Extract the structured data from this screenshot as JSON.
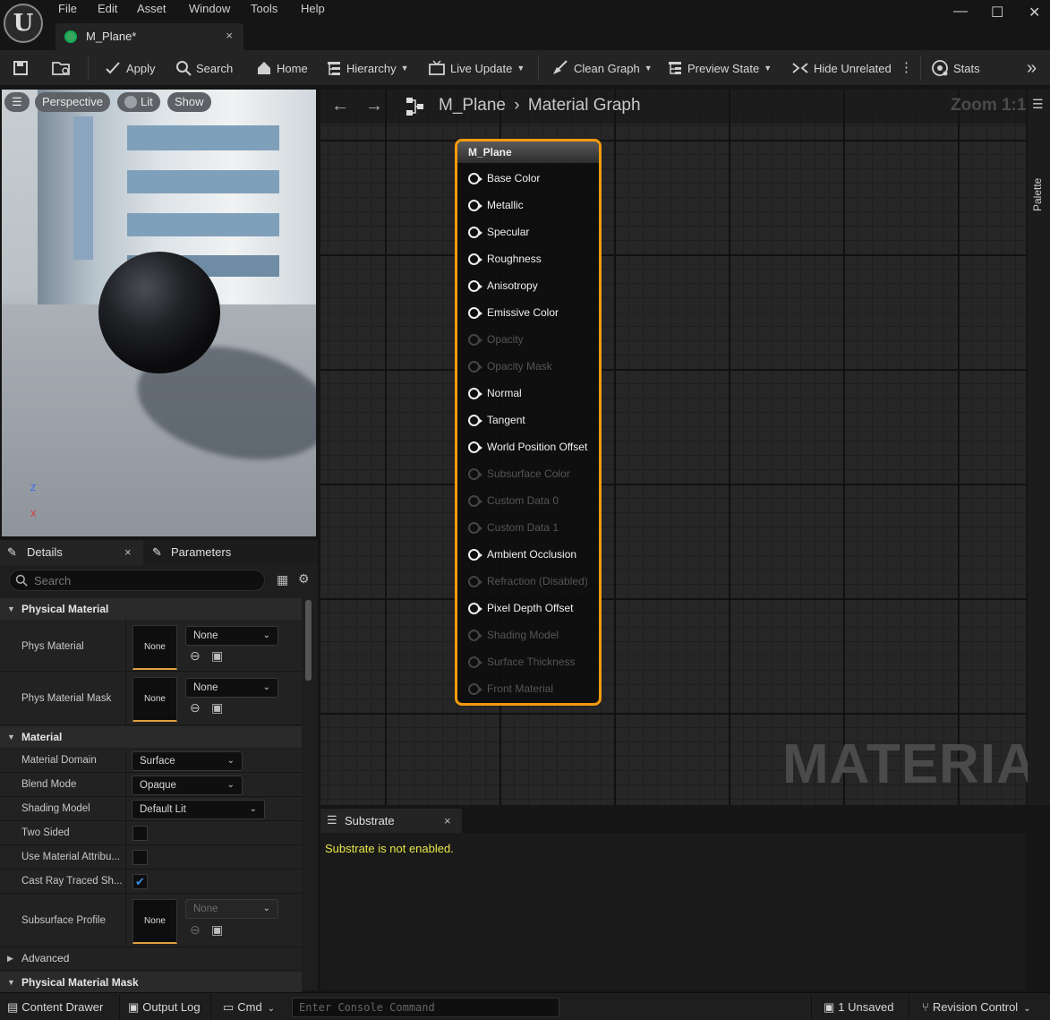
{
  "menu": {
    "items": [
      "File",
      "Edit",
      "Asset",
      "Window",
      "Tools",
      "Help"
    ]
  },
  "document_tab": {
    "title": "M_Plane*",
    "close": "×"
  },
  "window_controls": {
    "minimize": "—",
    "maximize": "☐",
    "close": "✕"
  },
  "toolbar": {
    "apply": "Apply",
    "search": "Search",
    "home": "Home",
    "hierarchy": "Hierarchy",
    "live_update": "Live Update",
    "clean_graph": "Clean Graph",
    "preview_state": "Preview State",
    "hide_unrelated": "Hide Unrelated",
    "stats": "Stats"
  },
  "viewport": {
    "perspective": "Perspective",
    "lit": "Lit",
    "show": "Show",
    "axis_z": "Z",
    "axis_x": "X"
  },
  "details_panel": {
    "tab_details": "Details",
    "tab_close": "×",
    "tab_parameters": "Parameters",
    "search_placeholder": "Search",
    "sections": {
      "physical_material": "Physical Material",
      "material": "Material",
      "advanced": "Advanced",
      "physical_material_mask": "Physical Material Mask"
    },
    "phys_material": {
      "label": "Phys Material",
      "thumb": "None",
      "value": "None"
    },
    "phys_material_mask": {
      "label": "Phys Material Mask",
      "thumb": "None",
      "value": "None"
    },
    "material_domain": {
      "label": "Material Domain",
      "value": "Surface"
    },
    "blend_mode": {
      "label": "Blend Mode",
      "value": "Opaque"
    },
    "shading_model": {
      "label": "Shading Model",
      "value": "Default Lit"
    },
    "two_sided": {
      "label": "Two Sided",
      "checked": false
    },
    "use_material_attributes": {
      "label": "Use Material Attribu...",
      "checked": false
    },
    "cast_ray_traced": {
      "label": "Cast Ray Traced Sh...",
      "checked": true
    },
    "subsurface_profile": {
      "label": "Subsurface Profile",
      "thumb": "None",
      "value": "None"
    }
  },
  "graph": {
    "breadcrumb_root": "M_Plane",
    "breadcrumb_sep": "›",
    "breadcrumb_leaf": "Material Graph",
    "zoom": "Zoom 1:1",
    "watermark": "MATERIAL",
    "palette": "Palette",
    "node": {
      "title": "M_Plane",
      "pins": [
        {
          "label": "Base Color",
          "enabled": true
        },
        {
          "label": "Metallic",
          "enabled": true
        },
        {
          "label": "Specular",
          "enabled": true
        },
        {
          "label": "Roughness",
          "enabled": true
        },
        {
          "label": "Anisotropy",
          "enabled": true
        },
        {
          "label": "Emissive Color",
          "enabled": true
        },
        {
          "label": "Opacity",
          "enabled": false
        },
        {
          "label": "Opacity Mask",
          "enabled": false
        },
        {
          "label": "Normal",
          "enabled": true
        },
        {
          "label": "Tangent",
          "enabled": true
        },
        {
          "label": "World Position Offset",
          "enabled": true
        },
        {
          "label": "Subsurface Color",
          "enabled": false
        },
        {
          "label": "Custom Data 0",
          "enabled": false
        },
        {
          "label": "Custom Data 1",
          "enabled": false
        },
        {
          "label": "Ambient Occlusion",
          "enabled": true
        },
        {
          "label": "Refraction (Disabled)",
          "enabled": false
        },
        {
          "label": "Pixel Depth Offset",
          "enabled": true
        },
        {
          "label": "Shading Model",
          "enabled": false
        },
        {
          "label": "Surface Thickness",
          "enabled": false
        },
        {
          "label": "Front Material",
          "enabled": false
        }
      ]
    }
  },
  "substrate": {
    "tab": "Substrate",
    "close": "×",
    "message": "Substrate is not enabled."
  },
  "statusbar": {
    "content_drawer": "Content Drawer",
    "output_log": "Output Log",
    "cmd": "Cmd",
    "console_placeholder": "Enter Console Command",
    "unsaved": "1 Unsaved",
    "revision_control": "Revision Control"
  },
  "colors": {
    "node_border": "#f29b0e",
    "message": "#e8e84a",
    "checkbox": "#3b8fe6"
  }
}
